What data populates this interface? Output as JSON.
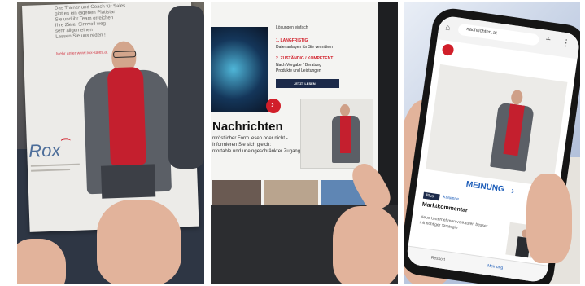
{
  "magazine": {
    "intro_lines": [
      "Das Trainer und Coach für Sales",
      "gibt es ein eigenen Plattstar",
      "Sie und ihr Team erreichen",
      "Ihre Ziele. Sinnvoll weg",
      "sehr allgemeinen",
      "Lassen Sie uns reden !"
    ],
    "red_line": "Mehr unter www.rox-sales.at",
    "logo": "Rox"
  },
  "laptop": {
    "top_text": "Lösungen einfach",
    "step1_label": "1. LANGFRISTIG",
    "step1_text": "Datenanlagen für Sie vermitteln",
    "step2_label": "2. ZUSTÄNDIG / KOMPETENT",
    "step2_text": "Nach Vorgabe / Beratung",
    "step2_sub": "Produkte und Leistungen",
    "cta": "JETZT LESEN",
    "headline": "Nachrichten",
    "body_lines": [
      "ntröstlicher Form lesen oder nicht -",
      "Informieren Sie sich gleich:",
      "nfortable und uneingeschränkter Zugang."
    ]
  },
  "phone": {
    "url": "nachrichten.at",
    "section": "MEINUNG",
    "badge": "Plus",
    "tag": "Kolumne",
    "article_title": "Marktkommentar",
    "lead_lines": [
      "Neue Unternehmen verkaufen besser",
      "mit richtiger Strategie"
    ],
    "nav": [
      "Ressort",
      "Meinung"
    ]
  },
  "colors": {
    "brand_red": "#d11f2a",
    "navy": "#1c2a4a",
    "link_blue": "#1a5bb8"
  }
}
